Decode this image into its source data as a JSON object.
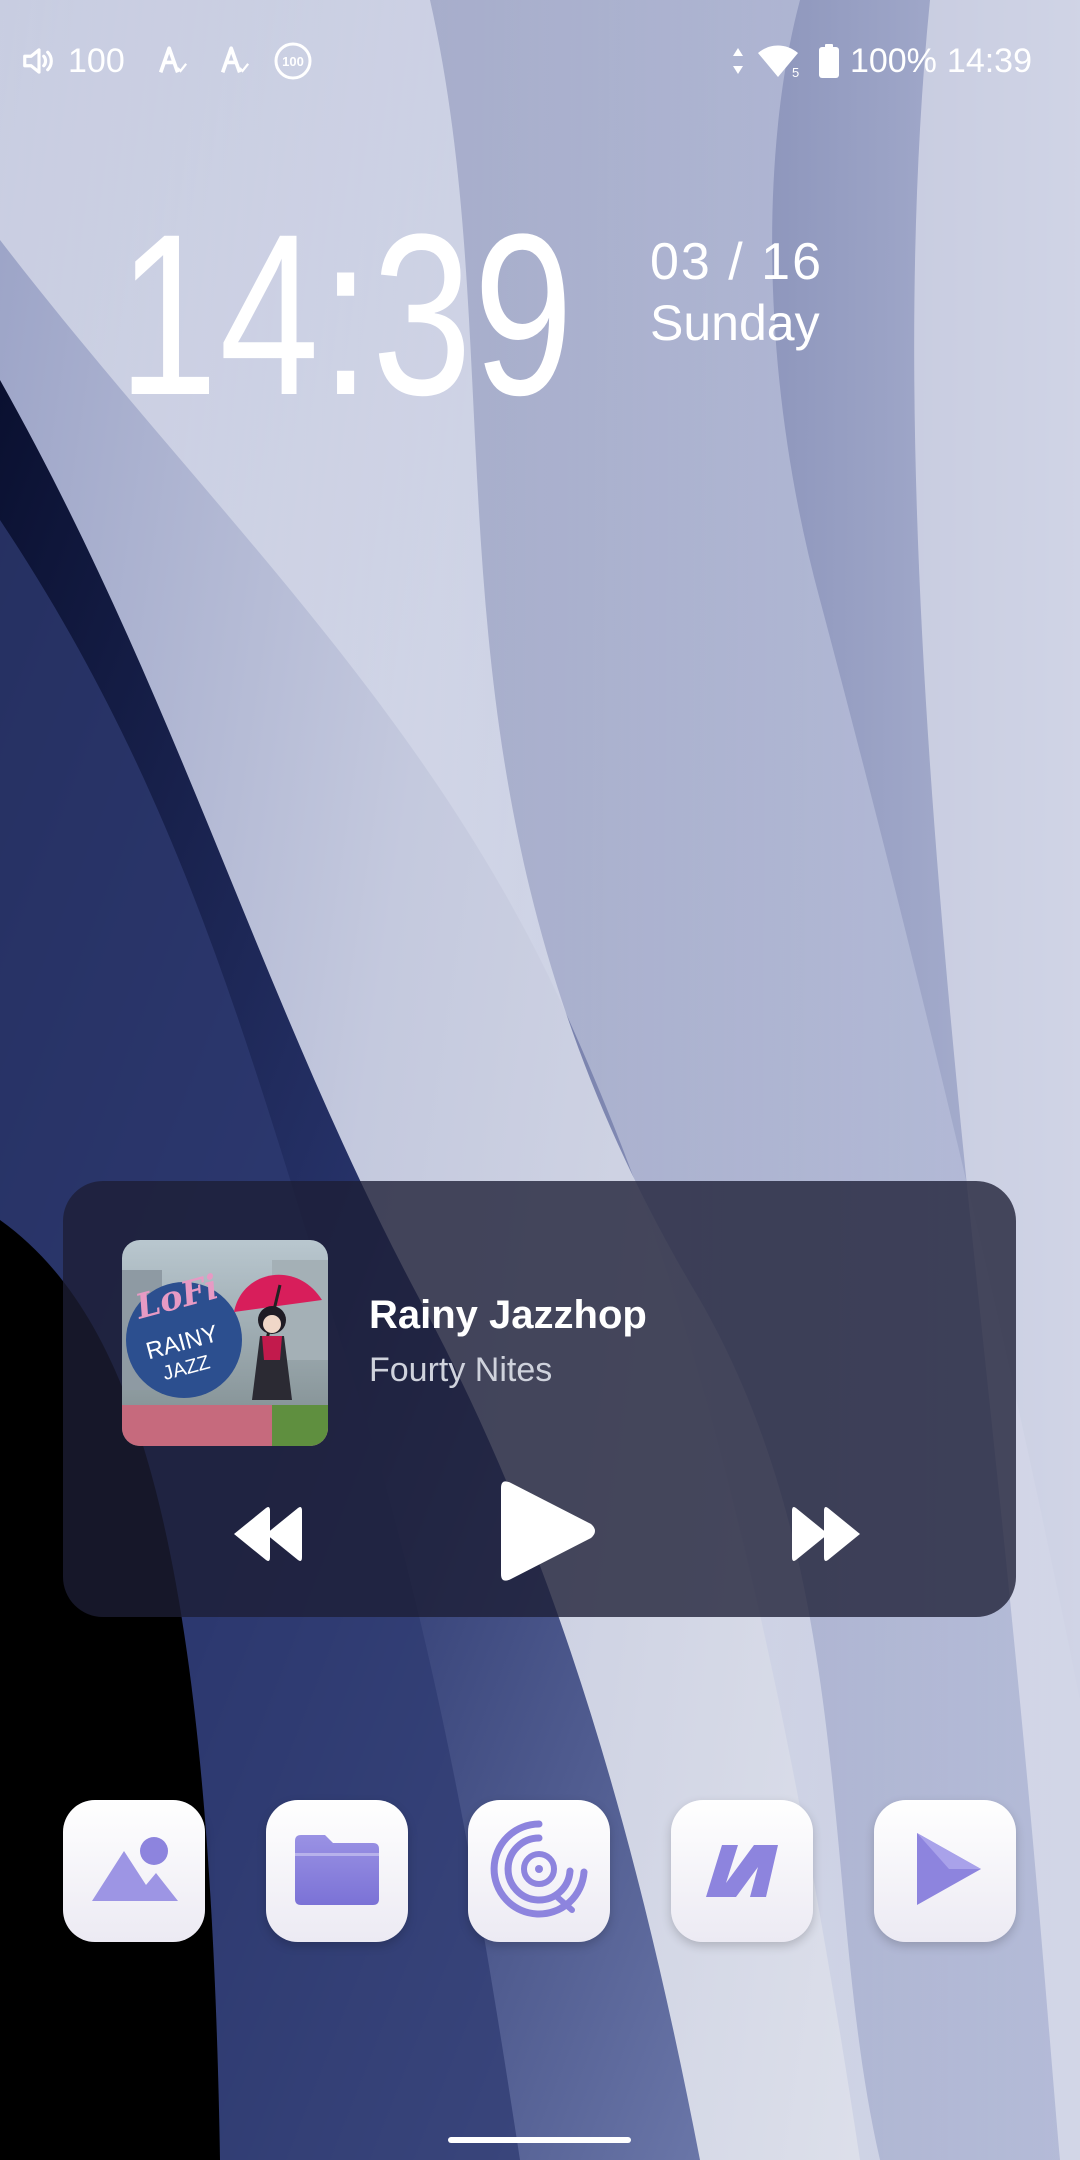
{
  "status_bar": {
    "volume_icon": "speaker-icon",
    "volume_level": "100",
    "notification_icons": [
      "auto-text-icon",
      "auto-text-icon",
      "badge-100-icon"
    ],
    "badge_value": "100",
    "network_icons": [
      "data-arrows-icon",
      "wifi-icon"
    ],
    "wifi_band": "5",
    "battery_icon": "battery-icon",
    "battery_percent": "100%",
    "time": "14:39"
  },
  "clock": {
    "time": "14:39",
    "date": "03 / 16",
    "day": "Sunday"
  },
  "media_player": {
    "album_art_text": "LoFi RAINY JAZZ",
    "title": "Rainy Jazzhop",
    "artist": "Fourty Nites",
    "controls": {
      "previous_icon": "rewind-icon",
      "play_icon": "play-icon",
      "next_icon": "fast-forward-icon"
    }
  },
  "dock": {
    "apps": [
      {
        "icon": "gallery-icon"
      },
      {
        "icon": "folder-icon"
      },
      {
        "icon": "music-disc-icon"
      },
      {
        "icon": "n-logo-icon"
      },
      {
        "icon": "play-store-icon"
      }
    ]
  },
  "colors": {
    "accent": "#7b72d6",
    "accent_light": "#a39be6",
    "card_background": "#1c1e34",
    "text_primary": "#ffffff"
  }
}
